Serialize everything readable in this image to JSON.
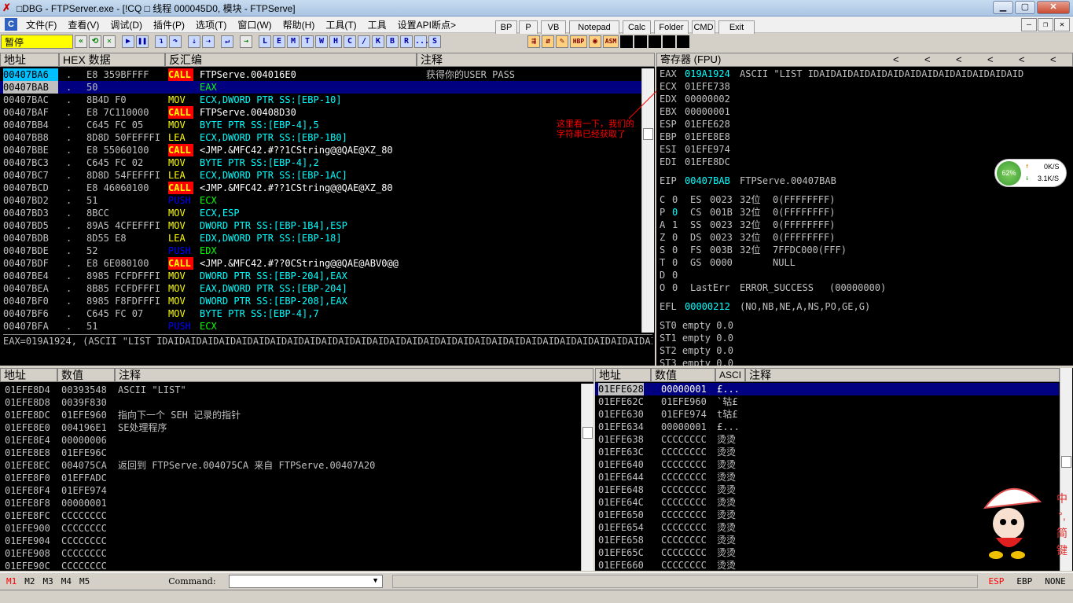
{
  "title": "□DBG - FTPServer.exe - [!CQ □  线程  000045D0, 模块 - FTPServe]",
  "menu": [
    "文件(F)",
    "查看(V)",
    "调试(D)",
    "插件(P)",
    "选项(T)",
    "窗口(W)",
    "帮助(H)",
    "工具(T)",
    "工具",
    "设置API断点>"
  ],
  "quick_buttons": [
    "BP",
    "P",
    "VB",
    "Notepad",
    "Calc",
    "Folder",
    "CMD",
    "Exit"
  ],
  "toolbar": {
    "paused_label": "暂停",
    "letters": [
      "L",
      "E",
      "M",
      "T",
      "W",
      "H",
      "C",
      "/",
      "K",
      "B",
      "R",
      "...",
      "S"
    ]
  },
  "disasm": {
    "headers": {
      "addr": "地址",
      "hex": "HEX 数据",
      "disasm": "反汇编",
      "comment": "注释"
    },
    "rows": [
      {
        "addr": "00407BA6",
        "dot": ".",
        "hex": "E8 359BFFFF",
        "op": "CALL",
        "args": "FTPServe.004016E0",
        "comment": "获得你的USER PASS",
        "cls": "call",
        "addr_hi": true
      },
      {
        "addr": "00407BAB",
        "dot": ".",
        "hex": "50",
        "op": "PUSH",
        "args": "EAX",
        "comment": "",
        "cls": "push",
        "selected": true
      },
      {
        "addr": "00407BAC",
        "dot": ".",
        "hex": "8B4D F0",
        "op": "MOV",
        "args": "ECX,DWORD PTR SS:[EBP-10]",
        "comment": "",
        "cls": "mov"
      },
      {
        "addr": "00407BAF",
        "dot": ".",
        "hex": "E8 7C110000",
        "op": "CALL",
        "args": "FTPServe.00408D30",
        "comment": "",
        "cls": "call"
      },
      {
        "addr": "00407BB4",
        "dot": ".",
        "hex": "C645 FC 05",
        "op": "MOV",
        "args": "BYTE PTR SS:[EBP-4],5",
        "comment": "",
        "cls": "mov"
      },
      {
        "addr": "00407BB8",
        "dot": ".",
        "hex": "8D8D 50FEFFFI",
        "op": "LEA",
        "args": "ECX,DWORD PTR SS:[EBP-1B0]",
        "comment": "",
        "cls": "lea"
      },
      {
        "addr": "00407BBE",
        "dot": ".",
        "hex": "E8 55060100",
        "op": "CALL",
        "args": "<JMP.&MFC42.#??1CString@@QAE@XZ_80",
        "comment": "",
        "cls": "call"
      },
      {
        "addr": "00407BC3",
        "dot": ".",
        "hex": "C645 FC 02",
        "op": "MOV",
        "args": "BYTE PTR SS:[EBP-4],2",
        "comment": "",
        "cls": "mov"
      },
      {
        "addr": "00407BC7",
        "dot": ".",
        "hex": "8D8D 54FEFFFI",
        "op": "LEA",
        "args": "ECX,DWORD PTR SS:[EBP-1AC]",
        "comment": "",
        "cls": "lea"
      },
      {
        "addr": "00407BCD",
        "dot": ".",
        "hex": "E8 46060100",
        "op": "CALL",
        "args": "<JMP.&MFC42.#??1CString@@QAE@XZ_80",
        "comment": "",
        "cls": "call"
      },
      {
        "addr": "00407BD2",
        "dot": ".",
        "hex": "51",
        "op": "PUSH",
        "args": "ECX",
        "comment": "",
        "cls": "push"
      },
      {
        "addr": "00407BD3",
        "dot": ".",
        "hex": "8BCC",
        "op": "MOV",
        "args": "ECX,ESP",
        "comment": "",
        "cls": "mov"
      },
      {
        "addr": "00407BD5",
        "dot": ".",
        "hex": "89A5 4CFEFFFI",
        "op": "MOV",
        "args": "DWORD PTR SS:[EBP-1B4],ESP",
        "comment": "",
        "cls": "mov"
      },
      {
        "addr": "00407BDB",
        "dot": ".",
        "hex": "8D55 E8",
        "op": "LEA",
        "args": "EDX,DWORD PTR SS:[EBP-18]",
        "comment": "",
        "cls": "lea"
      },
      {
        "addr": "00407BDE",
        "dot": ".",
        "hex": "52",
        "op": "PUSH",
        "args": "EDX",
        "comment": "",
        "cls": "push"
      },
      {
        "addr": "00407BDF",
        "dot": ".",
        "hex": "E8 6E080100",
        "op": "CALL",
        "args": "<JMP.&MFC42.#??0CString@@QAE@ABV0@@",
        "comment": "",
        "cls": "call"
      },
      {
        "addr": "00407BE4",
        "dot": ".",
        "hex": "8985 FCFDFFFI",
        "op": "MOV",
        "args": "DWORD PTR SS:[EBP-204],EAX",
        "comment": "",
        "cls": "mov"
      },
      {
        "addr": "00407BEA",
        "dot": ".",
        "hex": "8B85 FCFDFFFI",
        "op": "MOV",
        "args": "EAX,DWORD PTR SS:[EBP-204]",
        "comment": "",
        "cls": "mov"
      },
      {
        "addr": "00407BF0",
        "dot": ".",
        "hex": "8985 F8FDFFFI",
        "op": "MOV",
        "args": "DWORD PTR SS:[EBP-208],EAX",
        "comment": "",
        "cls": "mov"
      },
      {
        "addr": "00407BF6",
        "dot": ".",
        "hex": "C645 FC 07",
        "op": "MOV",
        "args": "BYTE PTR SS:[EBP-4],7",
        "comment": "",
        "cls": "mov"
      },
      {
        "addr": "00407BFA",
        "dot": ".",
        "hex": "51",
        "op": "PUSH",
        "args": "ECX",
        "comment": "",
        "cls": "push"
      }
    ],
    "info_line": "EAX=019A1924, (ASCII \"LIST IDAIDAIDAIDAIDAIDAIDAIDAIDAIDAIDAIDAIDAIDAIDAIDAIDAIDAIDAIDAIDAIDAIDAIDAIDAIDAIDAIDAIDAIDA"
  },
  "annotation": {
    "line1": "这里看一下，我们的",
    "line2": "字符串已经获取了"
  },
  "registers": {
    "header": "寄存器 (FPU)",
    "nav": [
      "<",
      "<",
      "<",
      "<",
      "<",
      "<"
    ],
    "gp": [
      {
        "name": "EAX",
        "val": "019A1924",
        "extra": "ASCII \"LIST IDAIDAIDAIDAIDAIDAIDAIDAIDAIDAIDAIDAID",
        "hi": true
      },
      {
        "name": "ECX",
        "val": "01EFE738",
        "extra": ""
      },
      {
        "name": "EDX",
        "val": "00000002",
        "extra": ""
      },
      {
        "name": "EBX",
        "val": "00000001",
        "extra": ""
      },
      {
        "name": "ESP",
        "val": "01EFE628",
        "extra": ""
      },
      {
        "name": "EBP",
        "val": "01EFE8E8",
        "extra": ""
      },
      {
        "name": "ESI",
        "val": "01EFE974",
        "extra": ""
      },
      {
        "name": "EDI",
        "val": "01EFE8DC",
        "extra": ""
      }
    ],
    "eip": {
      "name": "EIP",
      "val": "00407BAB",
      "extra": "FTPServe.00407BAB"
    },
    "flags": [
      {
        "f": "C",
        "v": "0",
        "seg": "ES",
        "sv": "0023",
        "bits": "32位",
        "rest": "0(FFFFFFFF)"
      },
      {
        "f": "P",
        "v": "0",
        "seg": "CS",
        "sv": "001B",
        "bits": "32位",
        "rest": "0(FFFFFFFF)",
        "vhi": true
      },
      {
        "f": "A",
        "v": "1",
        "seg": "SS",
        "sv": "0023",
        "bits": "32位",
        "rest": "0(FFFFFFFF)"
      },
      {
        "f": "Z",
        "v": "0",
        "seg": "DS",
        "sv": "0023",
        "bits": "32位",
        "rest": "0(FFFFFFFF)"
      },
      {
        "f": "S",
        "v": "0",
        "seg": "FS",
        "sv": "003B",
        "bits": "32位",
        "rest": "7FFDC000(FFF)"
      },
      {
        "f": "T",
        "v": "0",
        "seg": "GS",
        "sv": "0000",
        "bits": "",
        "rest": "NULL"
      },
      {
        "f": "D",
        "v": "0",
        "seg": "",
        "sv": "",
        "bits": "",
        "rest": ""
      },
      {
        "f": "O",
        "v": "0",
        "seg": "LastErr",
        "sv": "ERROR_SUCCESS",
        "bits": "",
        "rest": "(00000000)"
      }
    ],
    "efl": {
      "name": "EFL",
      "val": "00000212",
      "extra": "(NO,NB,NE,A,NS,PO,GE,G)"
    },
    "fpu": [
      "ST0 empty 0.0",
      "ST1 empty 0.0",
      "ST2 empty 0.0",
      "ST3 empty 0.0"
    ]
  },
  "net_widget": {
    "percent": "62%",
    "up": "0K/S",
    "down": "3.1K/S"
  },
  "dump": {
    "headers": {
      "addr": "地址",
      "val": "数值",
      "comment": "注释"
    },
    "rows": [
      {
        "addr": "01EFE8D4",
        "val": "00393548",
        "comment": "ASCII \"LIST\""
      },
      {
        "addr": "01EFE8D8",
        "val": "0039F830",
        "comment": ""
      },
      {
        "addr": "01EFE8DC",
        "val": "01EFE960",
        "comment": "指向下一个 SEH 记录的指针"
      },
      {
        "addr": "01EFE8E0",
        "val": "004196E1",
        "comment": "SE处理程序"
      },
      {
        "addr": "01EFE8E4",
        "val": "00000006",
        "comment": ""
      },
      {
        "addr": "01EFE8E8",
        "val": "01EFE96C",
        "comment": ""
      },
      {
        "addr": "01EFE8EC",
        "val": "004075CA",
        "comment": "返回到 FTPServe.004075CA 来自 FTPServe.00407A20"
      },
      {
        "addr": "01EFE8F0",
        "val": "01EFFADC",
        "comment": ""
      },
      {
        "addr": "01EFE8F4",
        "val": "01EFE974",
        "comment": ""
      },
      {
        "addr": "01EFE8F8",
        "val": "00000001",
        "comment": ""
      },
      {
        "addr": "01EFE8FC",
        "val": "CCCCCCCC",
        "comment": ""
      },
      {
        "addr": "01EFE900",
        "val": "CCCCCCCC",
        "comment": ""
      },
      {
        "addr": "01EFE904",
        "val": "CCCCCCCC",
        "comment": ""
      },
      {
        "addr": "01EFE908",
        "val": "CCCCCCCC",
        "comment": ""
      },
      {
        "addr": "01EFE90C",
        "val": "CCCCCCCC",
        "comment": ""
      }
    ]
  },
  "stack": {
    "headers": {
      "addr": "地址",
      "val": "数值",
      "ascii": "ASCI",
      "comment": "注释"
    },
    "rows": [
      {
        "addr": "01EFE628",
        "val": "00000001",
        "ascii": "£...",
        "selected": true
      },
      {
        "addr": "01EFE62C",
        "val": "01EFE960",
        "ascii": "`轱£"
      },
      {
        "addr": "01EFE630",
        "val": "01EFE974",
        "ascii": "t轱£"
      },
      {
        "addr": "01EFE634",
        "val": "00000001",
        "ascii": "£..."
      },
      {
        "addr": "01EFE638",
        "val": "CCCCCCCC",
        "ascii": "烫烫"
      },
      {
        "addr": "01EFE63C",
        "val": "CCCCCCCC",
        "ascii": "烫烫"
      },
      {
        "addr": "01EFE640",
        "val": "CCCCCCCC",
        "ascii": "烫烫"
      },
      {
        "addr": "01EFE644",
        "val": "CCCCCCCC",
        "ascii": "烫烫"
      },
      {
        "addr": "01EFE648",
        "val": "CCCCCCCC",
        "ascii": "烫烫"
      },
      {
        "addr": "01EFE64C",
        "val": "CCCCCCCC",
        "ascii": "烫烫"
      },
      {
        "addr": "01EFE650",
        "val": "CCCCCCCC",
        "ascii": "烫烫"
      },
      {
        "addr": "01EFE654",
        "val": "CCCCCCCC",
        "ascii": "烫烫"
      },
      {
        "addr": "01EFE658",
        "val": "CCCCCCCC",
        "ascii": "烫烫"
      },
      {
        "addr": "01EFE65C",
        "val": "CCCCCCCC",
        "ascii": "烫烫"
      },
      {
        "addr": "01EFE660",
        "val": "CCCCCCCC",
        "ascii": "烫烫"
      }
    ]
  },
  "ime": [
    "中",
    "°,",
    "简",
    "键"
  ],
  "bottom": {
    "memtabs": [
      "M1",
      "M2",
      "M3",
      "M4",
      "M5"
    ],
    "command_label": "Command:",
    "command_value": "",
    "regs": [
      "ESP",
      "EBP",
      "NONE"
    ]
  }
}
